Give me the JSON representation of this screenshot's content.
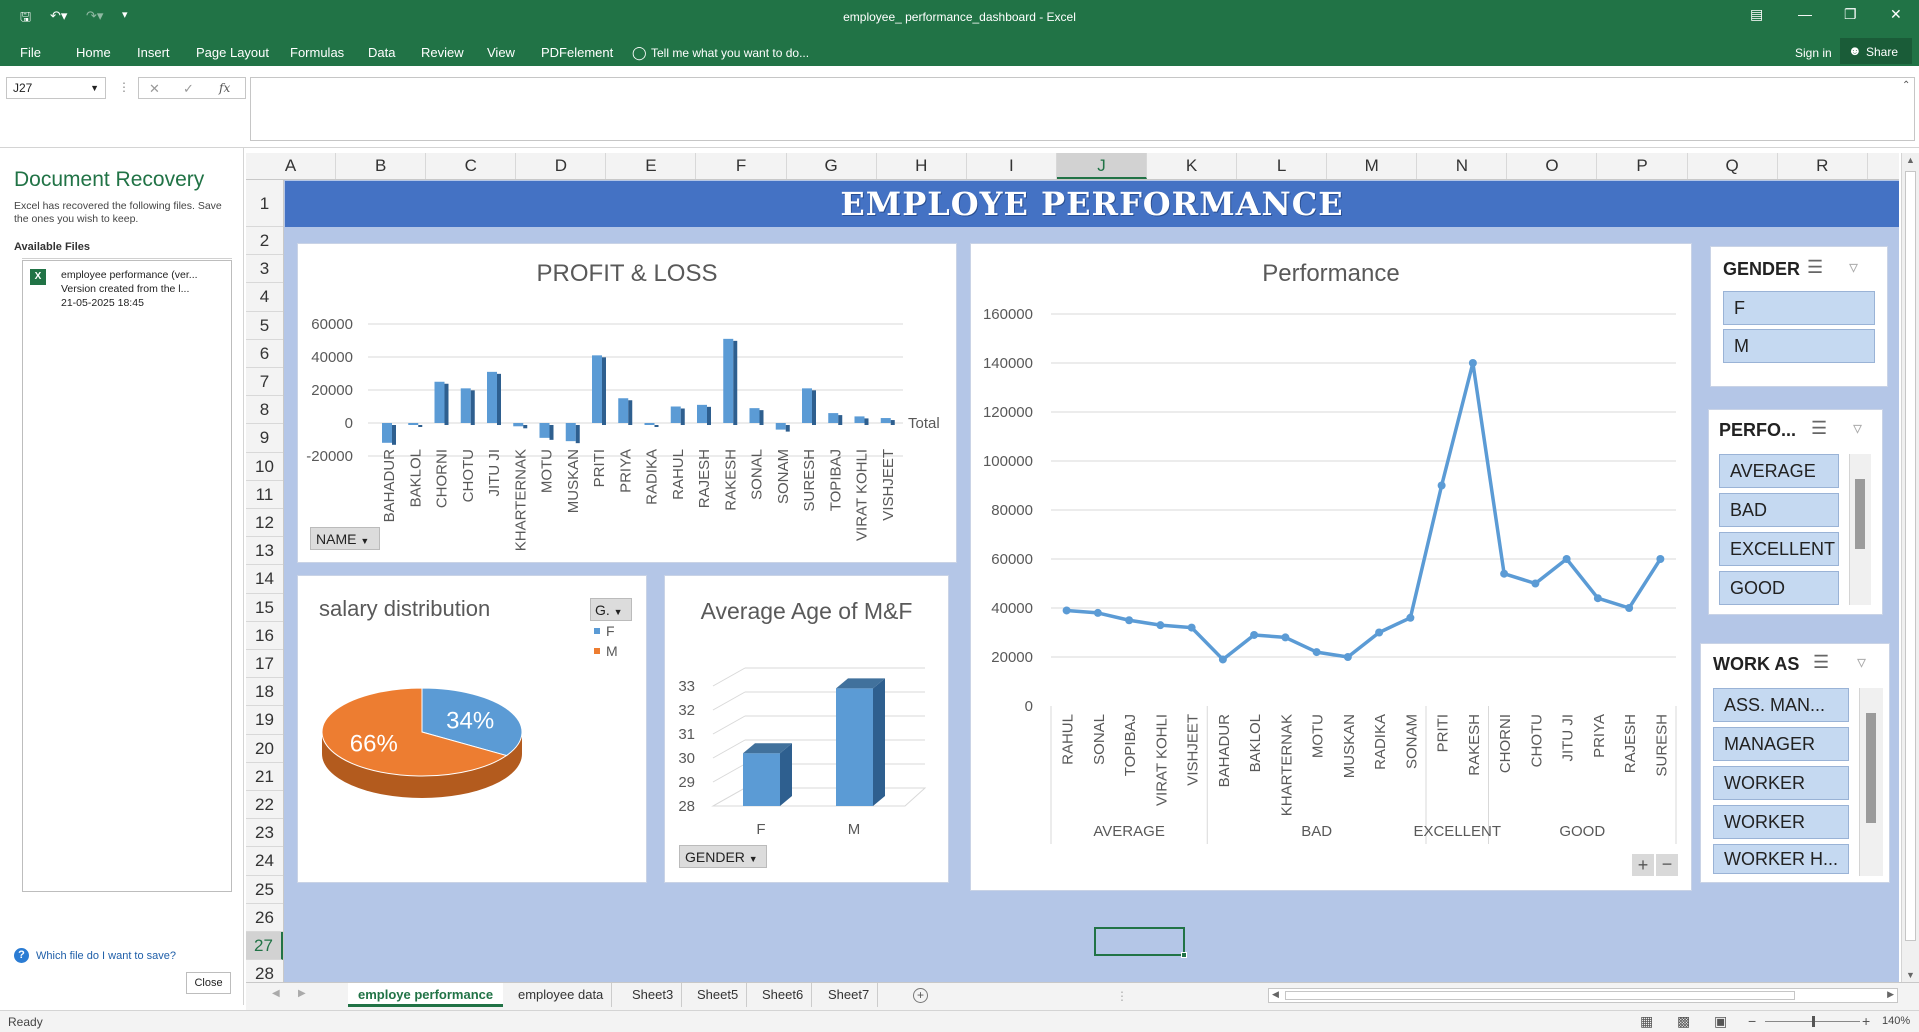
{
  "window": {
    "title": "employee_ performance_dashboard - Excel"
  },
  "ribbon": {
    "tabs": [
      "File",
      "Home",
      "Insert",
      "Page Layout",
      "Formulas",
      "Data",
      "Review",
      "View",
      "PDFelement"
    ],
    "tell_me": "Tell me what you want to do...",
    "signin": "Sign in",
    "share": "Share"
  },
  "formula_bar": {
    "name_box": "J27",
    "fx": "fx",
    "value": ""
  },
  "recovery": {
    "title": "Document Recovery",
    "desc": "Excel has recovered the following files. Save the ones you wish to keep.",
    "available": "Available Files",
    "file_name": "employee performance (ver...",
    "file_version": "Version created from the l...",
    "file_date": "21-05-2025 18:45",
    "help_link": "Which file do I want to save?",
    "close": "Close"
  },
  "grid": {
    "columns": [
      "A",
      "B",
      "C",
      "D",
      "E",
      "F",
      "G",
      "H",
      "I",
      "J",
      "K",
      "L",
      "M",
      "N",
      "O",
      "P",
      "Q",
      "R"
    ],
    "rows": [
      "1",
      "2",
      "3",
      "4",
      "5",
      "6",
      "7",
      "8",
      "9",
      "10",
      "11",
      "12",
      "13",
      "14",
      "15",
      "16",
      "17",
      "18",
      "19",
      "20",
      "21",
      "22",
      "23",
      "24",
      "25",
      "26",
      "27",
      "28"
    ]
  },
  "dashboard": {
    "banner": "EMPLOYE PERFORMANCE"
  },
  "profit_chart": {
    "title": "PROFIT & LOSS",
    "filter_button": "NAME",
    "legend": "Total",
    "chart_data": {
      "type": "bar",
      "title": "PROFIT & LOSS",
      "categories": [
        "BAHADUR",
        "BAKLOL",
        "CHORNI",
        "CHOTU",
        "JITU JI",
        "KHARTERNAK",
        "MOTU",
        "MUSKAN",
        "PRITI",
        "PRIYA",
        "RADIKA",
        "RAHUL",
        "RAJESH",
        "RAKESH",
        "SONAL",
        "SONAM",
        "SURESH",
        "TOPIBAJ",
        "VIRAT KOHLI",
        "VISHJEET"
      ],
      "series": [
        {
          "name": "Total",
          "values": [
            -12000,
            -1000,
            25000,
            21000,
            31000,
            -2000,
            -9000,
            -11000,
            41000,
            15000,
            0,
            10000,
            11000,
            51000,
            9000,
            -4000,
            21000,
            6000,
            4000,
            3000
          ]
        }
      ],
      "ylim": [
        -20000,
        60000
      ],
      "yticks": [
        "60000",
        "40000",
        "20000",
        "0",
        "-20000"
      ]
    }
  },
  "salary_chart": {
    "title": "salary distribution",
    "filter_button": "G.",
    "legend": [
      "F",
      "M"
    ],
    "chart_data": {
      "type": "pie",
      "title": "salary distribution",
      "labels": [
        "F",
        "M"
      ],
      "values": [
        34,
        66
      ],
      "data_labels": [
        "34%",
        "66%"
      ],
      "colors": [
        "#5b9bd5",
        "#ed7d31"
      ]
    }
  },
  "age_chart": {
    "title": "Average Age of M&F",
    "filter_button": "GENDER",
    "chart_data": {
      "type": "bar",
      "title": "Average Age of M&F",
      "categories": [
        "F",
        "M"
      ],
      "values": [
        30.2,
        32.9
      ],
      "ylim": [
        28,
        33
      ],
      "yticks": [
        "33",
        "32",
        "31",
        "30",
        "29",
        "28"
      ]
    }
  },
  "performance_chart": {
    "title": "Performance",
    "chart_data": {
      "type": "line",
      "title": "Performance",
      "categories": [
        "RAHUL",
        "SONAL",
        "TOPIBAJ",
        "VIRAT KOHLI",
        "VISHJEET",
        "BAHADUR",
        "BAKLOL",
        "KHARTERNAK",
        "MOTU",
        "MUSKAN",
        "RADIKA",
        "SONAM",
        "PRITI",
        "RAKESH",
        "CHORNI",
        "CHOTU",
        "JITU JI",
        "PRIYA",
        "RAJESH",
        "SURESH"
      ],
      "groups": [
        {
          "label": "AVERAGE",
          "count": 5
        },
        {
          "label": "BAD",
          "count": 7
        },
        {
          "label": "EXCELLENT",
          "count": 2
        },
        {
          "label": "GOOD",
          "count": 6
        }
      ],
      "values": [
        39000,
        38000,
        35000,
        33000,
        32000,
        19000,
        29000,
        28000,
        22000,
        20000,
        30000,
        36000,
        90000,
        140000,
        54000,
        50000,
        60000,
        44000,
        40000,
        60000
      ],
      "ylim": [
        0,
        160000
      ],
      "yticks": [
        "160000",
        "140000",
        "120000",
        "100000",
        "80000",
        "60000",
        "40000",
        "20000",
        "0"
      ],
      "color": "#5b9bd5"
    }
  },
  "slicers": {
    "gender": {
      "title": "GENDER",
      "items": [
        "F",
        "M"
      ]
    },
    "performance": {
      "title": "PERFO...",
      "items": [
        "AVERAGE",
        "BAD",
        "EXCELLENT",
        "GOOD"
      ]
    },
    "work_as": {
      "title": "WORK AS",
      "items": [
        "ASS. MAN...",
        "MANAGER",
        "WORKER",
        "WORKER",
        "WORKER H..."
      ]
    }
  },
  "sheet_tabs": [
    "employe performance",
    "employee data",
    "Sheet3",
    "Sheet5",
    "Sheet6",
    "Sheet7"
  ],
  "status": {
    "ready": "Ready",
    "zoom": "140%"
  }
}
